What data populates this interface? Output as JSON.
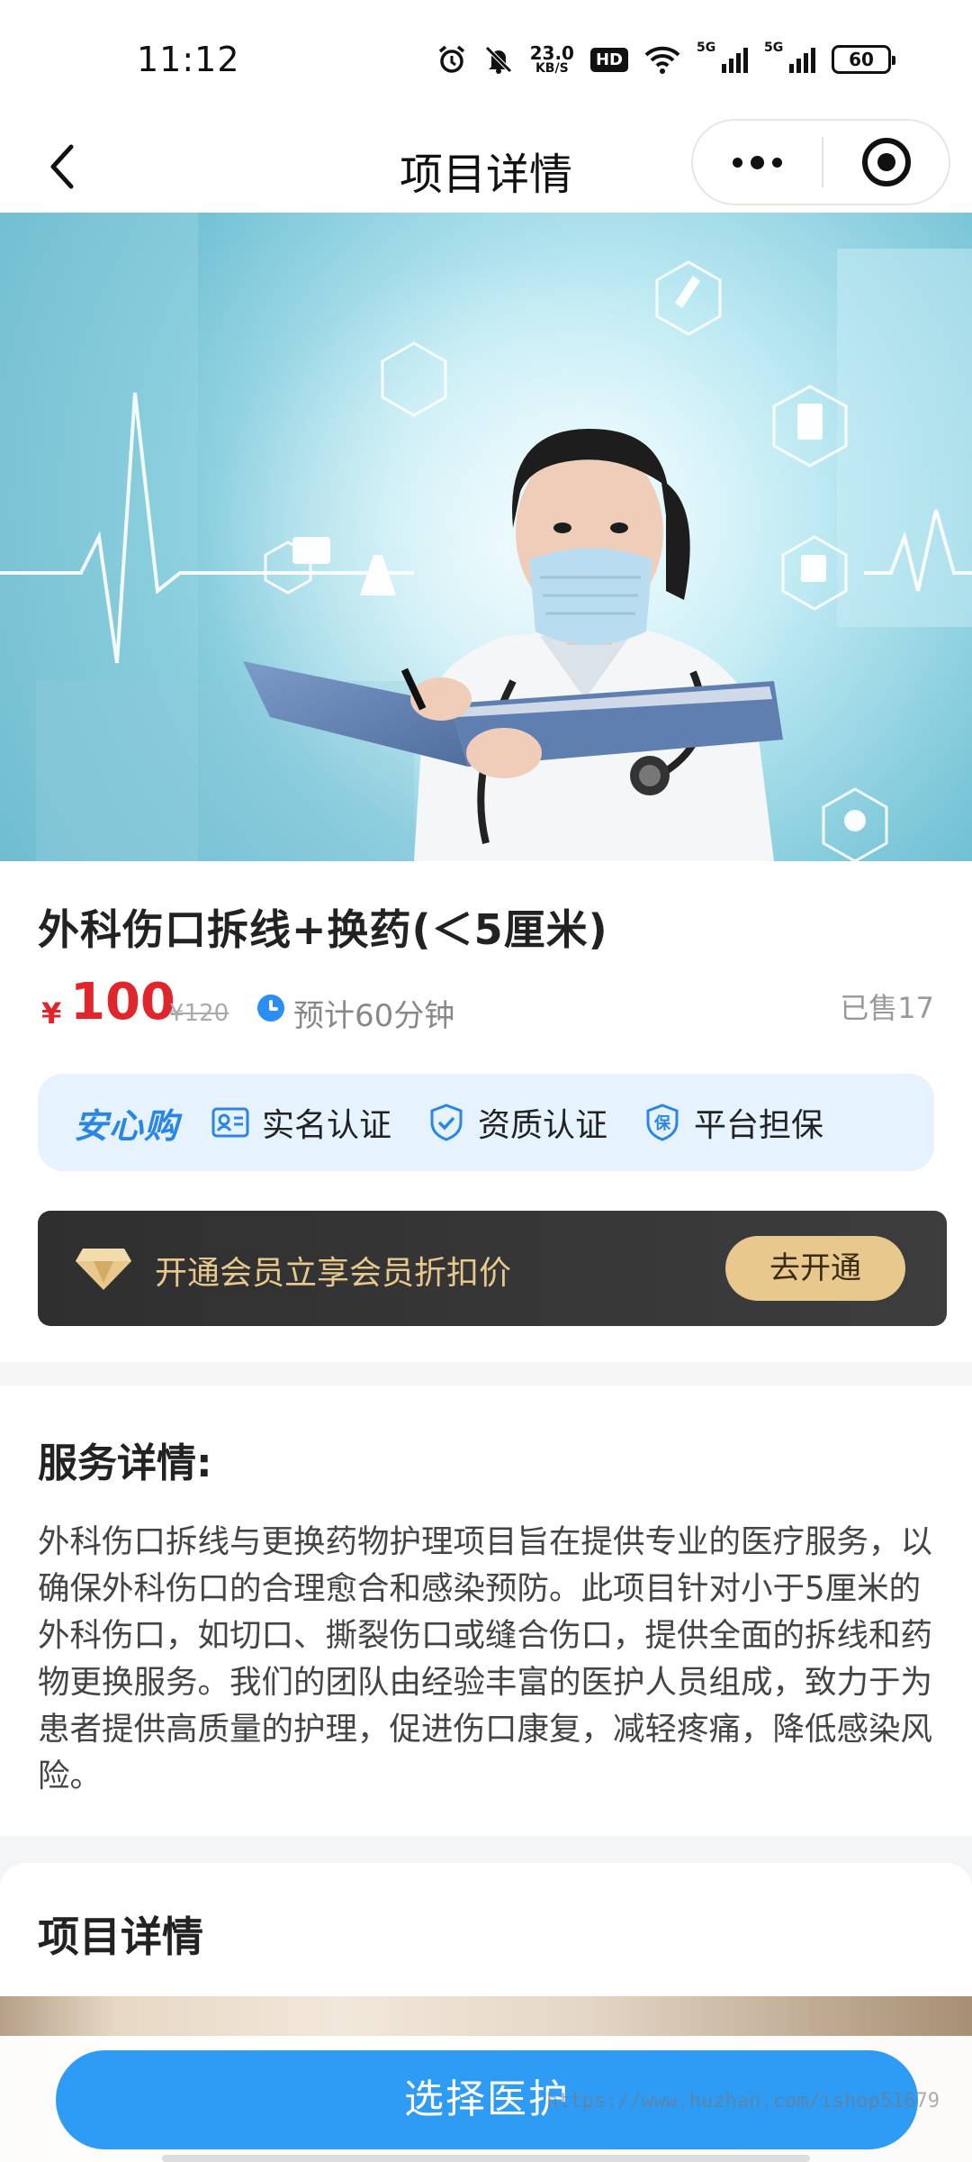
{
  "status_bar": {
    "time": "11:12",
    "net_speed_value": "23.0",
    "net_speed_unit": "KB/S",
    "hd_label": "HD",
    "signal_1_label": "5G",
    "signal_2_label": "5G",
    "battery_level": "60"
  },
  "navbar": {
    "title": "项目详情",
    "back_icon": "chevron-left-icon",
    "more_icon": "more-dots-icon",
    "close_icon": "target-close-icon"
  },
  "product": {
    "title": "外科伤口拆线+换药(＜5厘米)",
    "currency": "¥",
    "price": "100",
    "original_price": "¥120",
    "duration": "预计60分钟",
    "sold": "已售17"
  },
  "trust_bar": {
    "brand": "安心购",
    "items": [
      {
        "label": "实名认证",
        "icon": "id-card-icon"
      },
      {
        "label": "资质认证",
        "icon": "shield-check-icon"
      },
      {
        "label": "平台担保",
        "icon": "shield-guarantee-icon"
      }
    ],
    "guarantee_char": "保"
  },
  "vip": {
    "text": "开通会员立享会员折扣价",
    "button": "去开通",
    "icon": "diamond-icon"
  },
  "service": {
    "title": "服务详情:",
    "description": "外科伤口拆线与更换药物护理项目旨在提供专业的医疗服务，以确保外科伤口的合理愈合和感染预防。此项目针对小于5厘米的外科伤口，如切口、撕裂伤口或缝合伤口，提供全面的拆线和药物更换服务。我们的团队由经验丰富的医护人员组成，致力于为患者提供高质量的护理，促进伤口康复，减轻疼痛，降低感染风险。"
  },
  "detail": {
    "title": "项目详情"
  },
  "cta": {
    "label": "选择医护"
  },
  "watermark": "https://www.huzhan.com/ishop51679",
  "colors": {
    "price_red": "#e0252c",
    "brand_blue": "#2a86e6",
    "cta_blue": "#2e9bf4",
    "vip_gold": "#e8c88c",
    "vip_dark": "#333333"
  }
}
